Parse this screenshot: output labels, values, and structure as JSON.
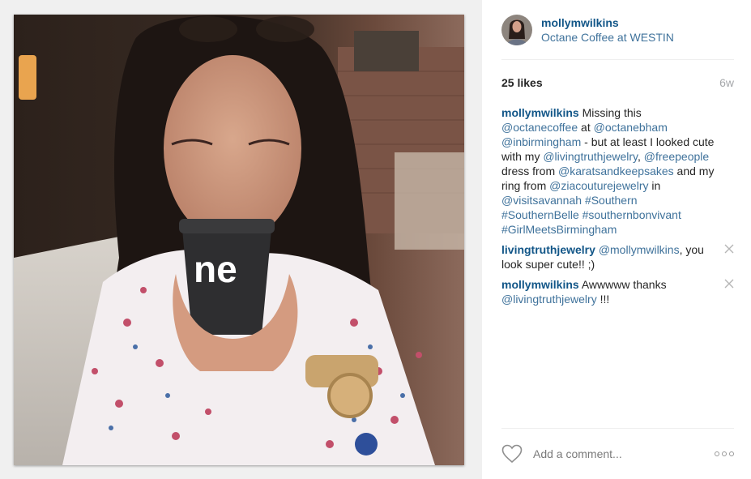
{
  "post": {
    "username": "mollymwilkins",
    "location": "Octane Coffee at WESTIN",
    "likes": "25 likes",
    "age": "6w"
  },
  "caption": {
    "user": "mollymwilkins",
    "t1": " Missing this ",
    "m1": "@octanecoffee",
    "t2": " at ",
    "m2": "@octanebham",
    "t3": " ",
    "m3": "@inbirmingham",
    "t4": " - but at least I looked cute with my ",
    "m4": "@livingtruthjewelry",
    "t5": ", ",
    "m5": "@freepeople",
    "t6": " dress from ",
    "m6": "@karatsandkeepsakes",
    "t7": " and my ring from ",
    "m7": "@ziacouturejewelry",
    "t8": " in ",
    "m8": "@visitsavannah",
    "t9": " ",
    "h1": "#Southern",
    "t10": " ",
    "h2": "#SouthernBelle",
    "t11": " ",
    "h3": "#southernbonvivant",
    "t12": " ",
    "h4": "#GirlMeetsBirmingham"
  },
  "comments": [
    {
      "user": "livingtruthjewelry",
      "t1": " ",
      "m1": "@mollymwilkins",
      "t2": ", you look super cute!! ;)"
    },
    {
      "user": "mollymwilkins",
      "t1": " Awwwww thanks ",
      "m1": "@livingtruthjewelry",
      "t2": " !!!"
    }
  ],
  "footer": {
    "placeholder": "Add a comment..."
  },
  "icons": {
    "heart": "heart-outline-icon",
    "more": "more-options-icon",
    "delete": "close-icon"
  },
  "colors": {
    "username": "#125688",
    "link": "#3f729b",
    "muted": "#a5a7aa"
  }
}
